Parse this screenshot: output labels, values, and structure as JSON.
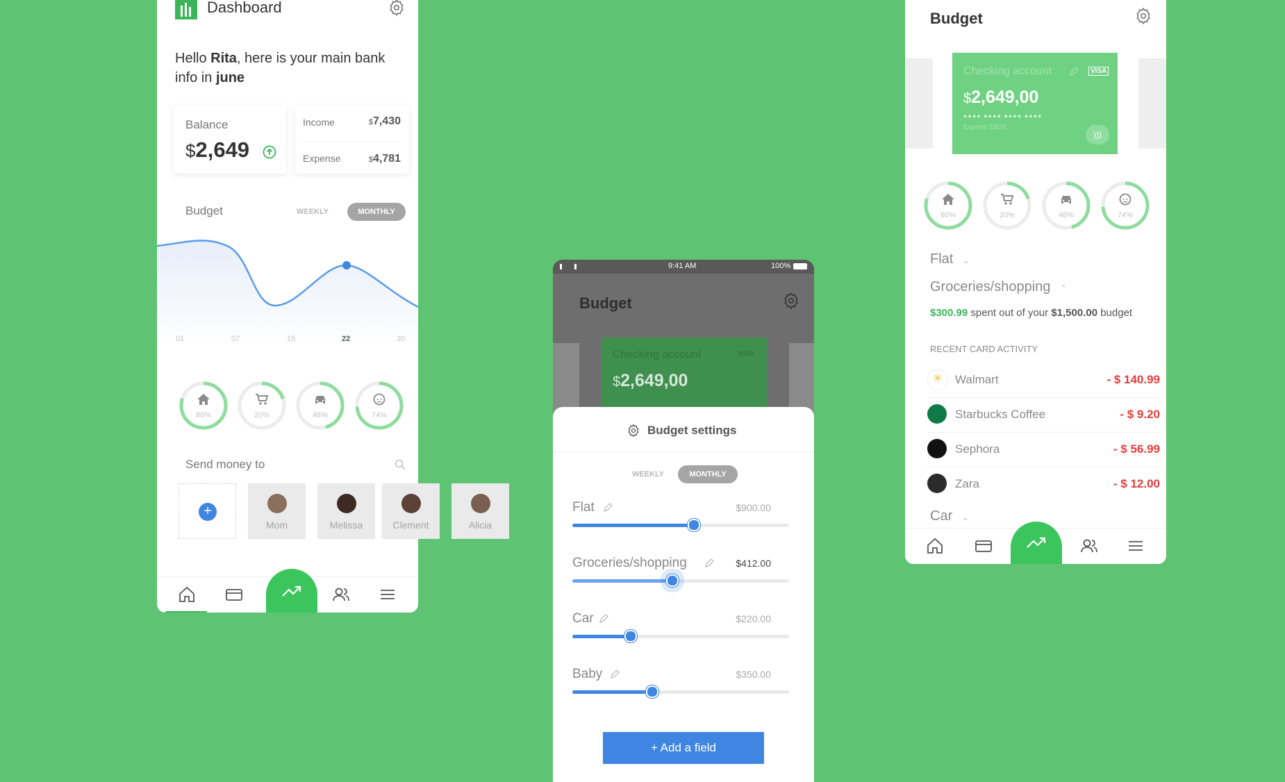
{
  "colors": {
    "green": "#5ec372",
    "card_green": "#6fd282",
    "blue": "#3f86e3",
    "red": "#e63c3c"
  },
  "dashboard": {
    "title": "Dashboard",
    "greeting_pre": "Hello ",
    "greeting_name": "Rita",
    "greeting_mid": ", here is your main bank info in ",
    "greeting_month": "june",
    "balance_label": "Balance",
    "balance_currency": "$",
    "balance_value": "2,649",
    "income_label": "Income",
    "income_currency": "$",
    "income_value": "7,430",
    "expense_label": "Expense",
    "expense_currency": "$",
    "expense_value": "4,781",
    "budget_label": "Budget",
    "weekly_label": "WEEKLY",
    "monthly_label": "MONTHLY",
    "chart_days": [
      "01",
      "07",
      "15",
      "22",
      "30"
    ],
    "chart_data": {
      "type": "line",
      "x": [
        "01",
        "07",
        "15",
        "22",
        "30"
      ],
      "highlighted": "22"
    },
    "categories": [
      {
        "icon": "home-icon",
        "pct": "80%",
        "value": 0.8
      },
      {
        "icon": "cart-icon",
        "pct": "20%",
        "value": 0.2
      },
      {
        "icon": "car-icon",
        "pct": "46%",
        "value": 0.46
      },
      {
        "icon": "baby-icon",
        "pct": "74%",
        "value": 0.74
      }
    ],
    "send_label": "Send money to",
    "contacts": [
      "Mom",
      "Melissa",
      "Clement",
      "Alicia"
    ]
  },
  "settings": {
    "status_time": "9:41 AM",
    "status_battery": "100%",
    "title": "Budget",
    "card_label": "Checking account",
    "card_brand": "VISA",
    "card_currency": "$",
    "card_amount": "2,649,00",
    "sheet_title": "Budget settings",
    "weekly_label": "WEEKLY",
    "monthly_label": "MONTHLY",
    "fields": [
      {
        "name": "Flat",
        "amount": "$900.00",
        "level": 0.56
      },
      {
        "name": "Groceries/shopping",
        "amount": "$412.00",
        "level": 0.46
      },
      {
        "name": "Car",
        "amount": "$220.00",
        "level": 0.27
      },
      {
        "name": "Baby",
        "amount": "$350.00",
        "level": 0.37
      }
    ],
    "add_button": "+ Add a field"
  },
  "budget": {
    "title": "Budget",
    "card_label": "Checking account",
    "card_brand": "VISA",
    "card_currency": "$",
    "card_amount": "2,649,00",
    "card_dots": "●●●●  ●●●●  ●●●●  ●●●●",
    "card_expiry": "Expires 03/24",
    "categories": [
      {
        "icon": "home-icon",
        "pct": "80%",
        "value": 0.8
      },
      {
        "icon": "cart-icon",
        "pct": "20%",
        "value": 0.2
      },
      {
        "icon": "car-icon",
        "pct": "46%",
        "value": 0.46
      },
      {
        "icon": "baby-icon",
        "pct": "74%",
        "value": 0.74
      }
    ],
    "flat_label": "Flat",
    "groceries_label": "Groceries/shopping",
    "spent": "$300.99",
    "spent_text": " spent out of your ",
    "budget_total": "$1,500.00",
    "budget_word": " budget",
    "recent_label": "RECENT CARD ACTIVITY",
    "activity": [
      {
        "name": "Walmart",
        "amount": "- $ 140.99"
      },
      {
        "name": "Starbucks Coffee",
        "amount": "- $ 9.20"
      },
      {
        "name": "Sephora",
        "amount": "- $ 56.99"
      },
      {
        "name": "Zara",
        "amount": "- $ 12.00"
      }
    ],
    "car_label": "Car"
  }
}
